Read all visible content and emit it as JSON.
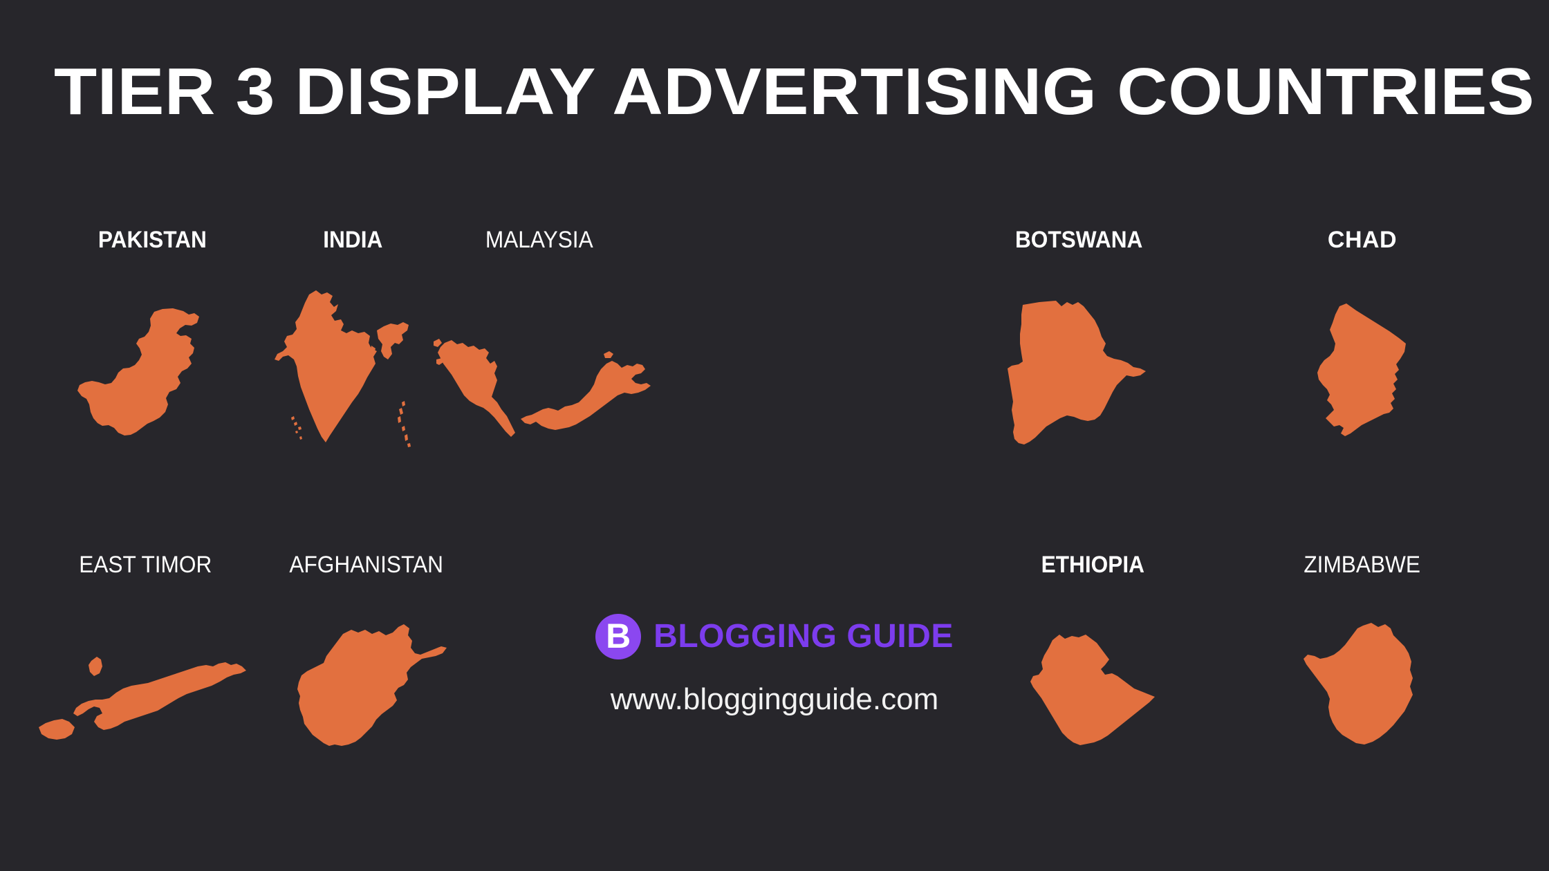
{
  "page": {
    "background_color": "#27262b",
    "map_color": "#e2703f",
    "text_color": "#ffffff",
    "title": "TIER 3 DISPLAY ADVERTISING COUNTRIES"
  },
  "countries": [
    {
      "name": "PAKISTAN",
      "map": "pakistan-map",
      "weight": "bold"
    },
    {
      "name": "INDIA",
      "map": "india-map",
      "weight": "bold"
    },
    {
      "name": "MALAYSIA",
      "map": "malaysia-map",
      "weight": "normal"
    },
    {
      "name": "BOTSWANA",
      "map": "botswana-map",
      "weight": "bold"
    },
    {
      "name": "CHAD",
      "map": "chad-map",
      "weight": "wide"
    },
    {
      "name": "EAST TIMOR",
      "map": "east-timor-map",
      "weight": "normal"
    },
    {
      "name": "AFGHANISTAN",
      "map": "afghanistan-map",
      "weight": "normal"
    },
    {
      "name": "ETHIOPIA",
      "map": "ethiopia-map",
      "weight": "bold"
    },
    {
      "name": "ZIMBABWE",
      "map": "zimbabwe-map",
      "weight": "normal"
    }
  ],
  "brand": {
    "badge_letter": "B",
    "name": "BLOGGING GUIDE",
    "url": "www.bloggingguide.com",
    "badge_color": "#8b47f0",
    "name_color": "#7c3ced"
  }
}
